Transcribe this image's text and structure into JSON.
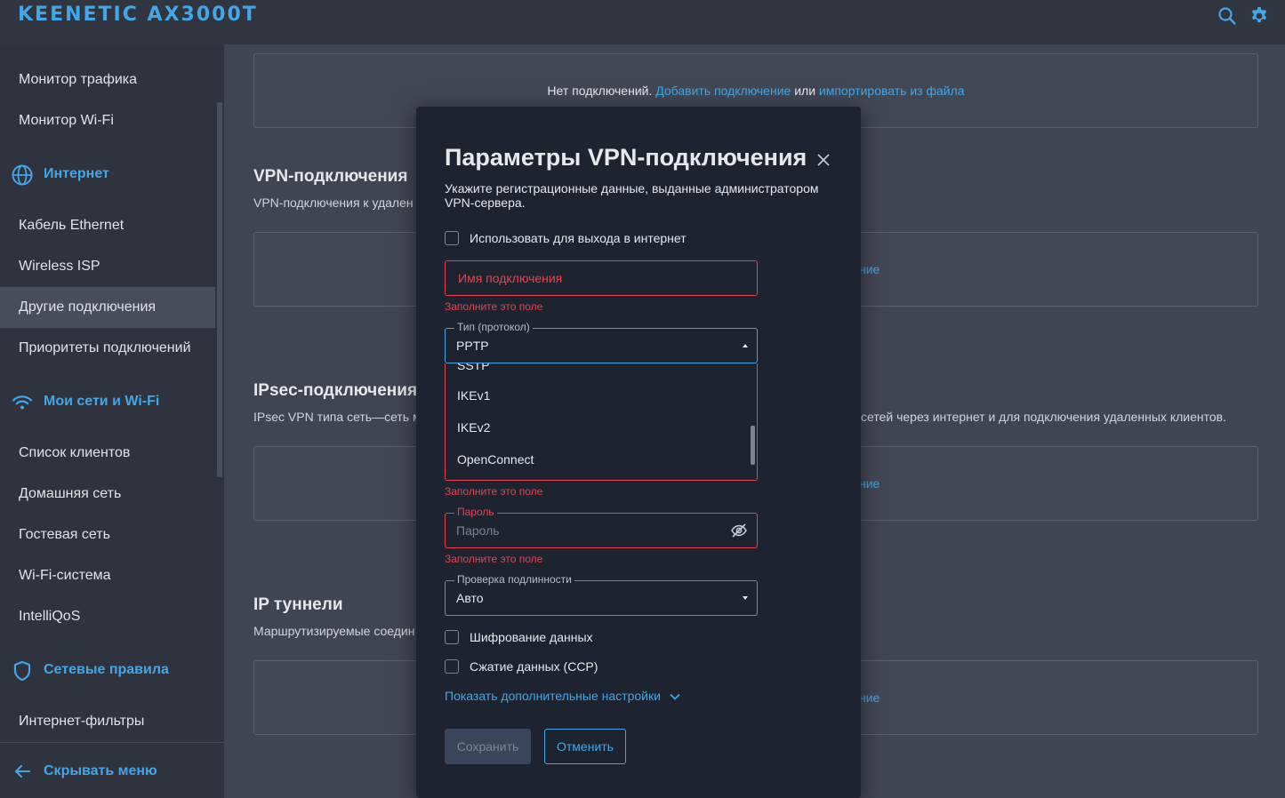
{
  "header": {
    "logo": "KEENETIC AX3000T"
  },
  "sidebar": {
    "items": [
      {
        "label": "Монитор трафика"
      },
      {
        "label": "Монитор Wi-Fi"
      },
      {
        "label": "Кабель Ethernet"
      },
      {
        "label": "Wireless ISP"
      },
      {
        "label": "Другие подключения"
      },
      {
        "label": "Приоритеты подключений"
      },
      {
        "label": "Список клиентов"
      },
      {
        "label": "Домашняя сеть"
      },
      {
        "label": "Гостевая сеть"
      },
      {
        "label": "Wi-Fi-система"
      },
      {
        "label": "IntelliQoS"
      },
      {
        "label": "Интернет-фильтры"
      }
    ],
    "groups": [
      {
        "label": "Интернет"
      },
      {
        "label": "Мои сети и Wi-Fi"
      },
      {
        "label": "Сетевые правила"
      }
    ],
    "footer": "Скрывать меню"
  },
  "main": {
    "top_card": {
      "text": "Нет подключений.",
      "link_add": "Добавить подключение",
      "or": "или",
      "link_import": "импортировать из файла"
    },
    "vpn": {
      "title": "VPN-подключения",
      "desc": "VPN-подключения к удален",
      "link": "ние"
    },
    "ipsec": {
      "title": "IPsec-подключения",
      "desc_left": "IPsec VPN типа сеть—сеть м",
      "desc_right": "сетей через интернет и для подключения удаленных клиентов.",
      "link": "ние"
    },
    "tunnels": {
      "title": "IP туннели",
      "desc": "Маршрутизируемые соедин",
      "link": "ние"
    }
  },
  "dialog": {
    "title": "Параметры VPN-подключения",
    "subtitle": "Укажите регистрационные данные, выданные администратором VPN-сервера.",
    "use_internet": "Использовать для выхода в интернет",
    "name_placeholder": "Имя подключения",
    "error": "Заполните это поле",
    "type_label": "Тип (протокол)",
    "type_value": "PPTP",
    "type_options": [
      "SSTP",
      "IKEv1",
      "IKEv2",
      "OpenConnect"
    ],
    "password_label": "Пароль",
    "password_placeholder": "Пароль",
    "auth_label": "Проверка подлинности",
    "auth_value": "Авто",
    "encryption": "Шифрование данных",
    "compression": "Сжатие данных (CCP)",
    "more": "Показать дополнительные настройки",
    "save": "Сохранить",
    "cancel": "Отменить"
  }
}
